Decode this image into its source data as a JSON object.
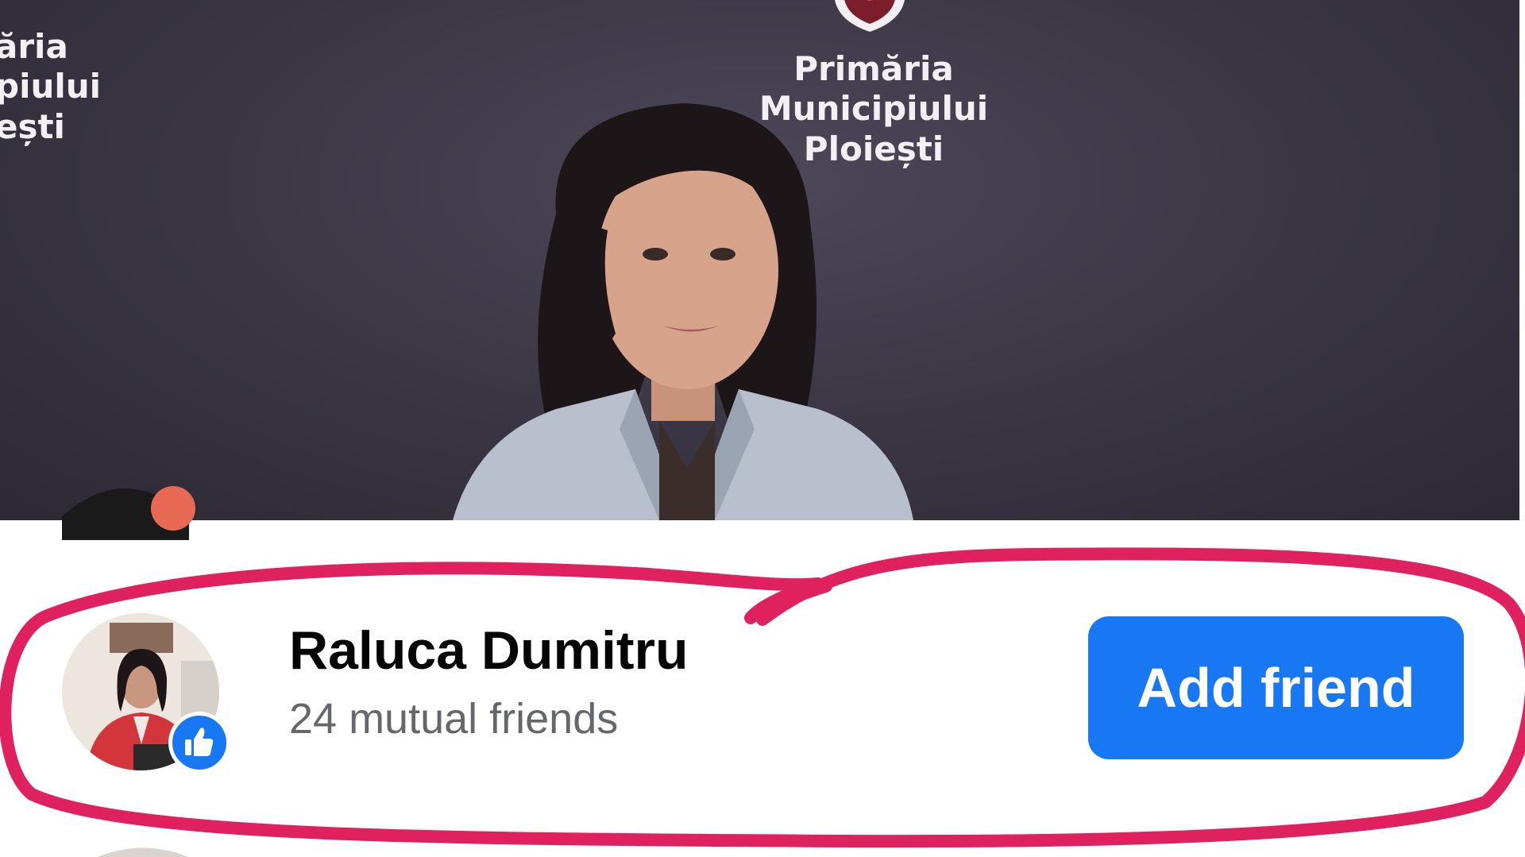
{
  "banner": {
    "backdrop_left_lines": [
      "ăria",
      "piului",
      "ești"
    ],
    "backdrop_center_lines": [
      "Primăria",
      "Municipiului",
      "Ploiești"
    ]
  },
  "friend": {
    "name": "Raluca Dumitru",
    "mutual": "24 mutual friends",
    "add_label": "Add friend"
  },
  "colors": {
    "accent": "#1877f2",
    "annotation": "#e0215f",
    "backdrop": "#3c3846"
  },
  "icons": {
    "like_badge": "thumbs-up-icon"
  }
}
